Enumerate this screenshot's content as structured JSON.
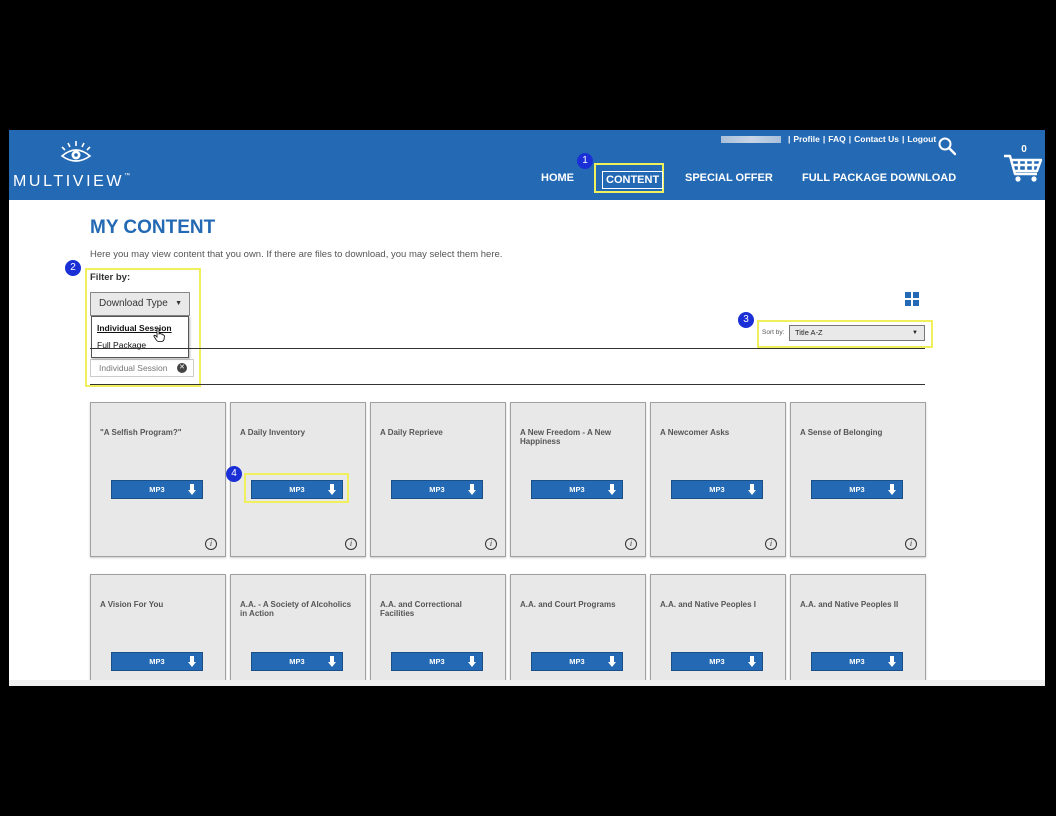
{
  "header": {
    "logo_text": "MULTIVIEW",
    "logo_tm": "™",
    "util_links": [
      "Profile",
      "FAQ",
      "Contact Us",
      "Logout"
    ],
    "cart_count": "0",
    "nav": {
      "home": "HOME",
      "content": "CONTENT",
      "special": "SPECIAL OFFER",
      "full": "FULL PACKAGE DOWNLOAD"
    },
    "brand_color": "#2369b3"
  },
  "markers": [
    "1",
    "2",
    "3",
    "4"
  ],
  "highlight_color": "#f0ef5c",
  "main": {
    "title": "MY CONTENT",
    "intro": "Here you may view content that you own. If there are files to download, you may select them here.",
    "filter": {
      "label": "Filter by:",
      "dropdown_label": "Download Type",
      "options": [
        "Individual Session",
        "Full Package"
      ],
      "active_chip": "Individual Session"
    },
    "sort": {
      "label": "Sort by:",
      "value": "Title A-Z"
    },
    "cards": [
      {
        "title": "\"A Selfish Program?\"",
        "button": "MP3"
      },
      {
        "title": "A Daily Inventory",
        "button": "MP3"
      },
      {
        "title": "A Daily Reprieve",
        "button": "MP3"
      },
      {
        "title": "A New Freedom - A New Happiness",
        "button": "MP3"
      },
      {
        "title": "A Newcomer Asks",
        "button": "MP3"
      },
      {
        "title": "A Sense of Belonging",
        "button": "MP3"
      },
      {
        "title": "A Vision For You",
        "button": "MP3"
      },
      {
        "title": "A.A. - A Society of Alcoholics in Action",
        "button": "MP3"
      },
      {
        "title": "A.A. and Correctional Facilities",
        "button": "MP3"
      },
      {
        "title": "A.A. and Court Programs",
        "button": "MP3"
      },
      {
        "title": "A.A. and Native Peoples I",
        "button": "MP3"
      },
      {
        "title": "A.A. and Native Peoples II",
        "button": "MP3"
      }
    ]
  }
}
